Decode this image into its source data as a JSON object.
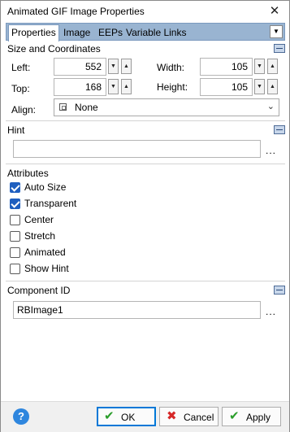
{
  "window": {
    "title": "Animated GIF Image Properties",
    "close_glyph": "✕"
  },
  "tabs": [
    {
      "label": "Properties",
      "active": true
    },
    {
      "label": "Image",
      "active": false
    },
    {
      "label": "EEPs",
      "active": false
    },
    {
      "label": "Variable Links",
      "active": false
    }
  ],
  "tab_dropdown_glyph": "▼",
  "size_group": {
    "header": "Size and Coordinates",
    "left_label": "Left:",
    "left_value": "552",
    "top_label": "Top:",
    "top_value": "168",
    "width_label": "Width:",
    "width_value": "105",
    "height_label": "Height:",
    "height_value": "105",
    "align_label": "Align:",
    "align_value": "None"
  },
  "hint_group": {
    "header": "Hint",
    "value": "",
    "browse_label": "..."
  },
  "attributes_group": {
    "header": "Attributes",
    "items": [
      {
        "label": "Auto Size",
        "checked": true
      },
      {
        "label": "Transparent",
        "checked": true
      },
      {
        "label": "Center",
        "checked": false
      },
      {
        "label": "Stretch",
        "checked": false
      },
      {
        "label": "Animated",
        "checked": false
      },
      {
        "label": "Show Hint",
        "checked": false
      }
    ]
  },
  "component_group": {
    "header": "Component ID",
    "value": "RBImage1",
    "browse_label": "..."
  },
  "footer": {
    "help_glyph": "?",
    "ok_label": "OK",
    "cancel_label": "Cancel",
    "apply_label": "Apply"
  },
  "colors": {
    "tab_bar": "#99b4d1",
    "check_on": "#1f5fbf",
    "ok_icon": "#2a9d2a",
    "cancel_icon": "#d62828",
    "help": "#2e86de"
  }
}
